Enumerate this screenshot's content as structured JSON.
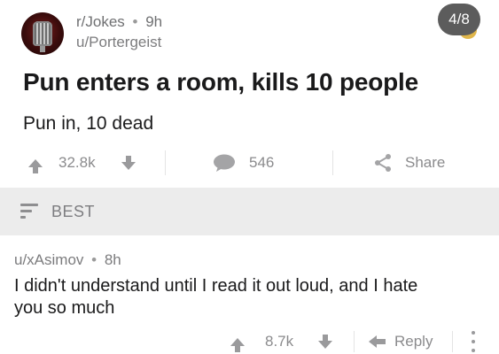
{
  "post": {
    "subreddit": "r/Jokes",
    "separator": "•",
    "age": "9h",
    "author": "u/Portergeist",
    "title": "Pun enters a room, kills 10 people",
    "body": "Pun in, 10 dead",
    "score": "32.8k",
    "comments": "546",
    "share_label": "Share"
  },
  "gallery": {
    "position": "4/8"
  },
  "sort": {
    "label": "BEST"
  },
  "comment": {
    "author": "u/xAsimov",
    "separator": "•",
    "age": "8h",
    "body": "I didn't understand until I read it out loud, and I hate you so much",
    "score": "8.7k",
    "reply_label": "Reply"
  },
  "icons": {
    "avatar": "subreddit-avatar-microphone",
    "upvote": "arrow-up-icon",
    "downvote": "arrow-down-icon",
    "comment": "speech-bubble-icon",
    "share": "share-icon",
    "sort": "sort-lines-icon",
    "reply": "reply-arrow-icon",
    "more": "kebab-menu-icon"
  },
  "colors": {
    "text_primary": "#1a1a1b",
    "text_muted": "#7c7c7e",
    "icon_gray": "#9a9a9c",
    "sort_band": "#ececec",
    "badge_bg": "#5c5c5c"
  }
}
